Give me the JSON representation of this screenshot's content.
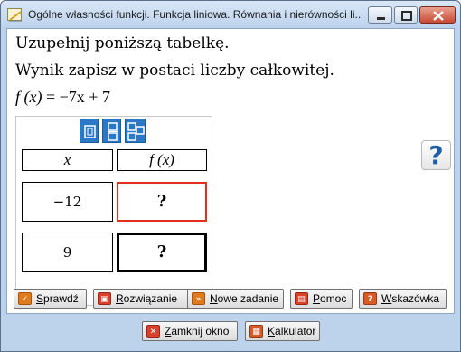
{
  "window": {
    "title": "Ogólne własności funkcji. Funkcja liniowa. Równania i nierówności li...",
    "controls": [
      "minimize",
      "maximize",
      "close"
    ]
  },
  "task": {
    "instruction_1": "Uzupełnij poniższą tabelkę.",
    "instruction_2": "Wynik zapisz w postaci liczby całkowitej.",
    "formula_lhs": "f (x)",
    "formula_rhs": "= −7x + 7"
  },
  "table": {
    "header_x": "x",
    "header_fx": "f (x)",
    "rows": [
      {
        "x": "−12",
        "fx": "?"
      },
      {
        "x": "9",
        "fx": "?"
      }
    ],
    "layout_buttons": [
      "single-layout-icon",
      "vertical-layout-icon",
      "grid-layout-icon"
    ]
  },
  "help": {
    "label": "?"
  },
  "actions": {
    "check_first": "S",
    "check_rest": "prawdź",
    "solution_first": "R",
    "solution_rest": "ozwiązanie",
    "new_first": "N",
    "new_rest": "owe zadanie",
    "help_first": "P",
    "help_rest": "omoc",
    "hint_first": "W",
    "hint_rest": "skazówka",
    "close_first": "Z",
    "close_rest": "amknij okno",
    "calc_pre": "",
    "calc_first": "K",
    "calc_rest": "alkulator"
  },
  "colors": {
    "active_cell_border": "#e0301e",
    "tool_button": "#2b78c6",
    "help_icon": "#1f5fa8"
  }
}
